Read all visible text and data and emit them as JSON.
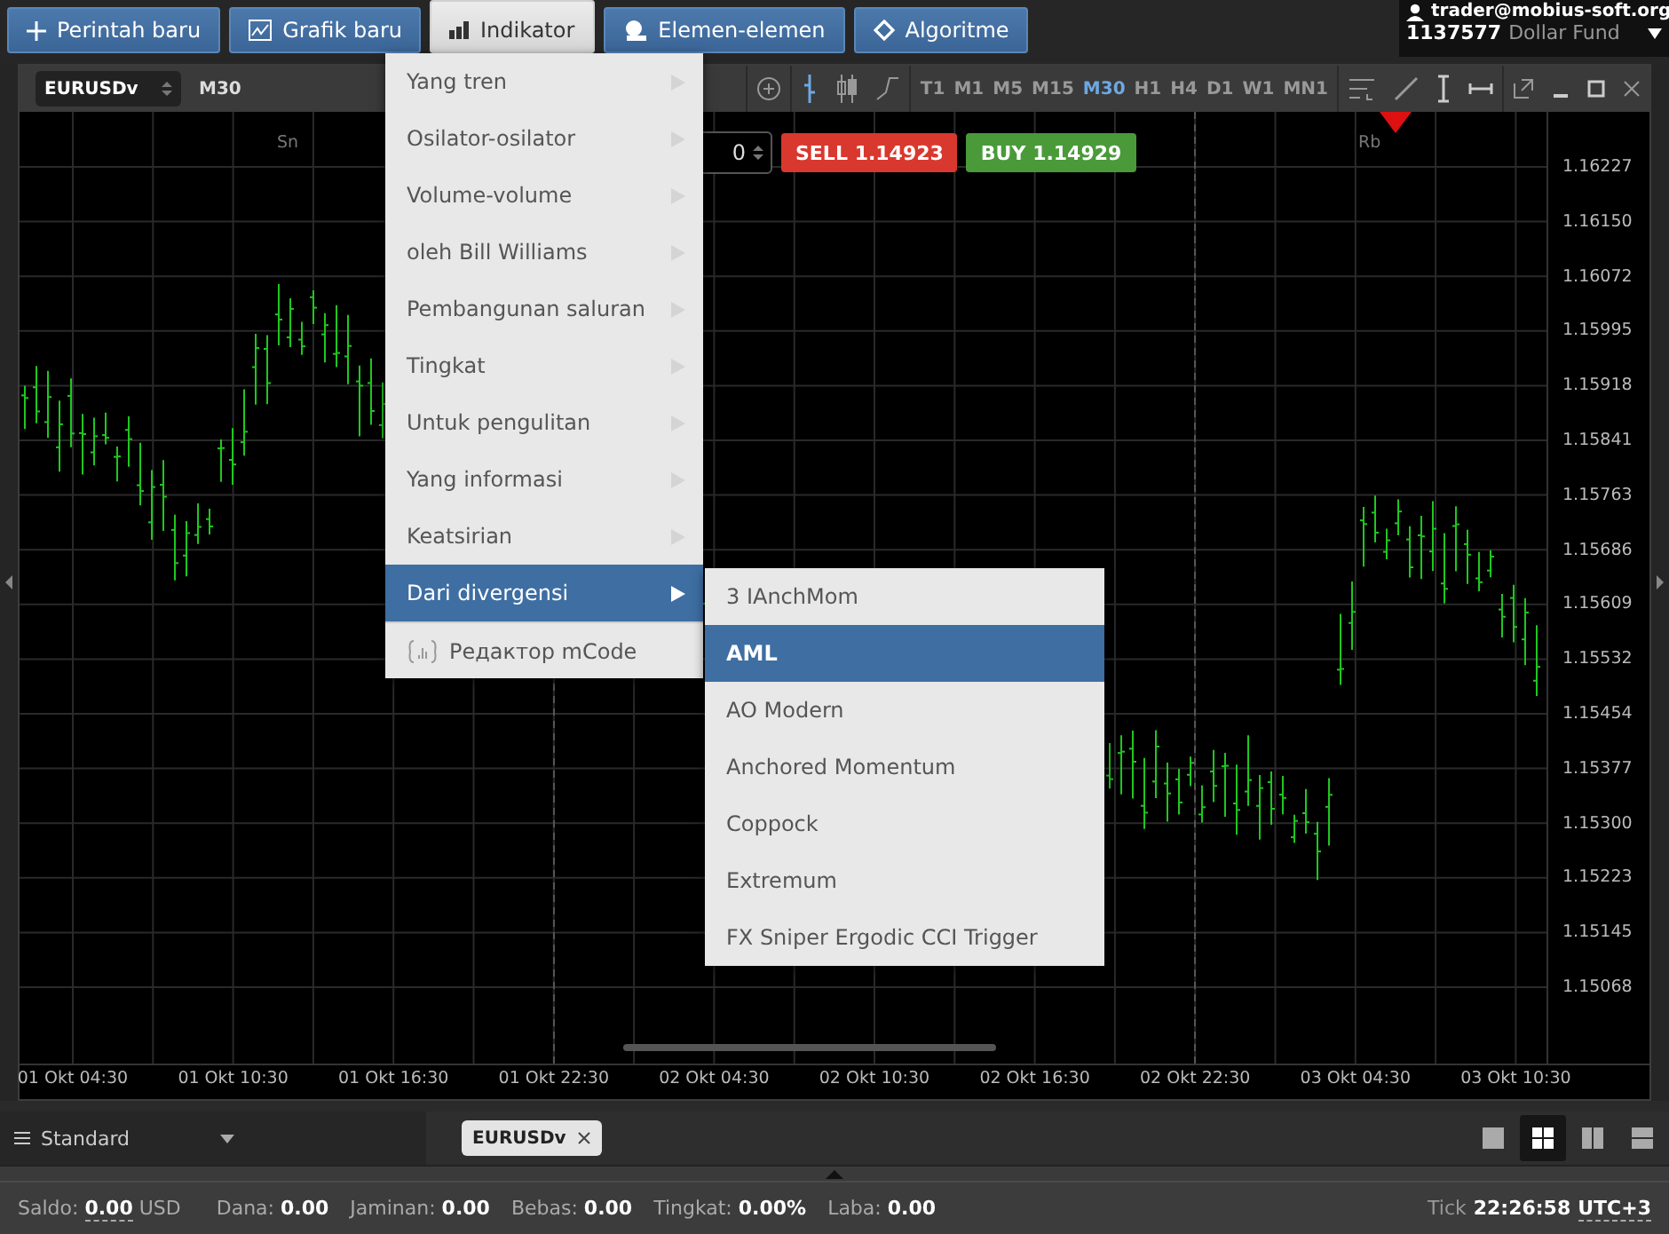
{
  "toolbar": {
    "buttons": [
      {
        "label": "Perintah baru",
        "kind": "plus",
        "selected": false
      },
      {
        "label": "Grafik baru",
        "kind": "chart",
        "selected": false
      },
      {
        "label": "Indikator",
        "kind": "bars",
        "selected": true
      },
      {
        "label": "Elemen-elemen",
        "kind": "shapes",
        "selected": false
      },
      {
        "label": "Algoritme",
        "kind": "diamond",
        "selected": false
      }
    ]
  },
  "account": {
    "email": "trader@mobius-soft.org",
    "number": "1137577",
    "name": "Dollar Fund"
  },
  "chart_window": {
    "symbol": "EURUSDv",
    "timeframe": "M30",
    "timeframes": [
      {
        "label": "T1",
        "selected": false
      },
      {
        "label": "M1",
        "selected": false
      },
      {
        "label": "M5",
        "selected": false
      },
      {
        "label": "M15",
        "selected": false
      },
      {
        "label": "M30",
        "selected": true
      },
      {
        "label": "H1",
        "selected": false
      },
      {
        "label": "H4",
        "selected": false
      },
      {
        "label": "D1",
        "selected": false
      },
      {
        "label": "W1",
        "selected": false
      },
      {
        "label": "MN1",
        "selected": false
      }
    ],
    "lot_value": "0",
    "sell": {
      "label": "SELL",
      "price": "1.14923"
    },
    "buy": {
      "label": "BUY",
      "price": "1.14929"
    },
    "day_labels": [
      "Sn",
      "Rb"
    ],
    "price_labels": [
      "1.16227",
      "1.16150",
      "1.16072",
      "1.15995",
      "1.15918",
      "1.15841",
      "1.15763",
      "1.15686",
      "1.15609",
      "1.15532",
      "1.15454",
      "1.15377",
      "1.15300",
      "1.15223",
      "1.15145",
      "1.15068"
    ],
    "time_labels": [
      "01 Okt 04:30",
      "01 Okt 10:30",
      "01 Okt 16:30",
      "01 Okt 22:30",
      "02 Okt 04:30",
      "02 Okt 10:30",
      "02 Okt 16:30",
      "02 Okt 22:30",
      "03 Okt 04:30",
      "03 Okt 10:30"
    ]
  },
  "menu": {
    "items": [
      {
        "label": "Yang tren",
        "kind": "submenu",
        "selected": false
      },
      {
        "label": "Osilator-osilator",
        "kind": "submenu",
        "selected": false
      },
      {
        "label": "Volume-volume",
        "kind": "submenu",
        "selected": false
      },
      {
        "label": "oleh Bill Williams",
        "kind": "submenu",
        "selected": false
      },
      {
        "label": "Pembangunan saluran",
        "kind": "submenu",
        "selected": false
      },
      {
        "label": "Tingkat",
        "kind": "submenu",
        "selected": false
      },
      {
        "label": "Untuk pengulitan",
        "kind": "submenu",
        "selected": false
      },
      {
        "label": "Yang informasi",
        "kind": "submenu",
        "selected": false
      },
      {
        "label": "Keatsirian",
        "kind": "submenu",
        "selected": false
      },
      {
        "label": "Dari divergensi",
        "kind": "submenu",
        "selected": true
      },
      {
        "label": "Редактор mCode",
        "kind": "editor",
        "selected": false
      }
    ]
  },
  "submenu": {
    "items": [
      {
        "label": "3 IAnchMom",
        "selected": false
      },
      {
        "label": "AML",
        "selected": true
      },
      {
        "label": "AO Modern",
        "selected": false
      },
      {
        "label": "Anchored Momentum",
        "selected": false
      },
      {
        "label": "Coppock",
        "selected": false
      },
      {
        "label": "Extremum",
        "selected": false
      },
      {
        "label": "FX Sniper Ergodic CCI Trigger",
        "selected": false
      }
    ]
  },
  "workspace": {
    "label": "Standard",
    "tabs": [
      {
        "label": "EURUSDv",
        "selected": true
      }
    ],
    "layouts": [
      {
        "kind": "single",
        "selected": false
      },
      {
        "kind": "grid",
        "selected": true
      },
      {
        "kind": "columns",
        "selected": false
      },
      {
        "kind": "rows",
        "selected": false
      }
    ]
  },
  "status_bar": {
    "fields": [
      {
        "label": "Saldo:",
        "value": "0.00",
        "unit": "USD"
      },
      {
        "label": "Dana:",
        "value": "0.00"
      },
      {
        "label": "Jaminan:",
        "value": "0.00"
      },
      {
        "label": "Bebas:",
        "value": "0.00"
      },
      {
        "label": "Tingkat:",
        "value": "0.00%"
      },
      {
        "label": "Laba:",
        "value": "0.00"
      }
    ],
    "tick_label": "Tick",
    "time": "22:26:58",
    "timezone": "UTC+3"
  }
}
